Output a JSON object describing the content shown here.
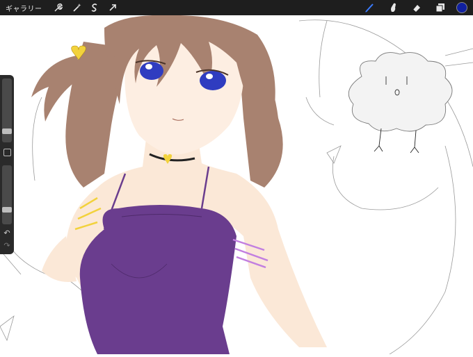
{
  "toolbar": {
    "gallery_label": "ギャラリー",
    "left_tools": [
      "wrench-icon",
      "magic-wand-icon",
      "selection-s-icon",
      "transform-arrow-icon"
    ],
    "right_tools": [
      "brush-icon",
      "smudge-icon",
      "eraser-icon",
      "layers-icon"
    ],
    "active_tool": "brush-icon",
    "current_color": "#1020a0"
  },
  "sidebar": {
    "brush_size_level": 0.7,
    "opacity_level": 0.5
  },
  "colors": {
    "toolbar_bg": "#1e1e1e",
    "accent": "#3a7bff",
    "hair": "#a88270",
    "skin": "#fbe8d7",
    "dress": "#6a3d8e",
    "eyes": "#2f3cc0",
    "yellow_ribbon": "#f2d23c",
    "pink_ribbon": "#c27fe0"
  }
}
